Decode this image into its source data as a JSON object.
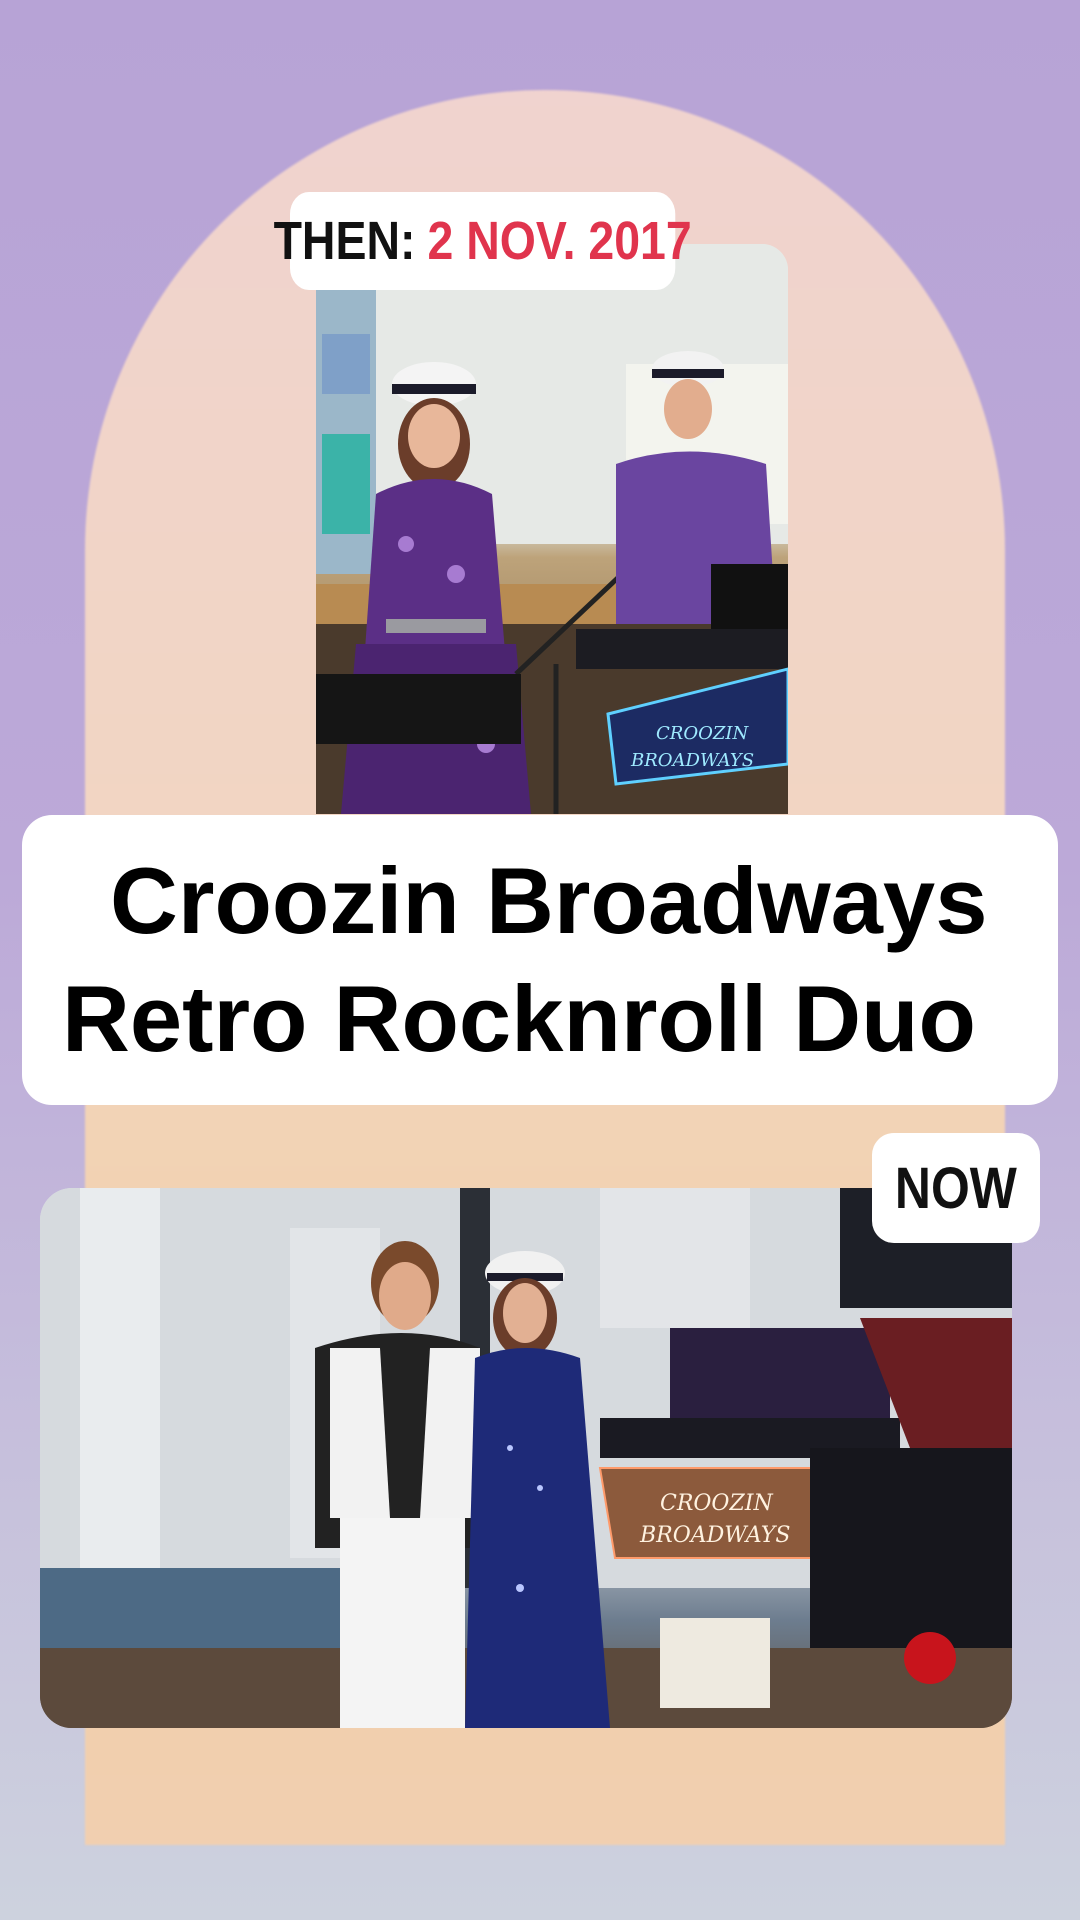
{
  "story": {
    "then_label": {
      "prefix": "THEN:",
      "date": "2 NOV. 2017"
    },
    "title": {
      "line1": "Croozin Broadways",
      "line2": "Retro Rocknroll Duo"
    },
    "now_label": "NOW",
    "then_photo_sign": {
      "line1": "CROOZIN",
      "line2": "BROADWAYS"
    },
    "now_photo_sign": {
      "line1": "CROOZIN",
      "line2": "BROADWAYS"
    }
  },
  "colors": {
    "background_top": "#b7a3d6",
    "arch": "#f2d6c2",
    "date_accent": "#e0344d",
    "label_bg": "#ffffff",
    "text": "#111111"
  }
}
